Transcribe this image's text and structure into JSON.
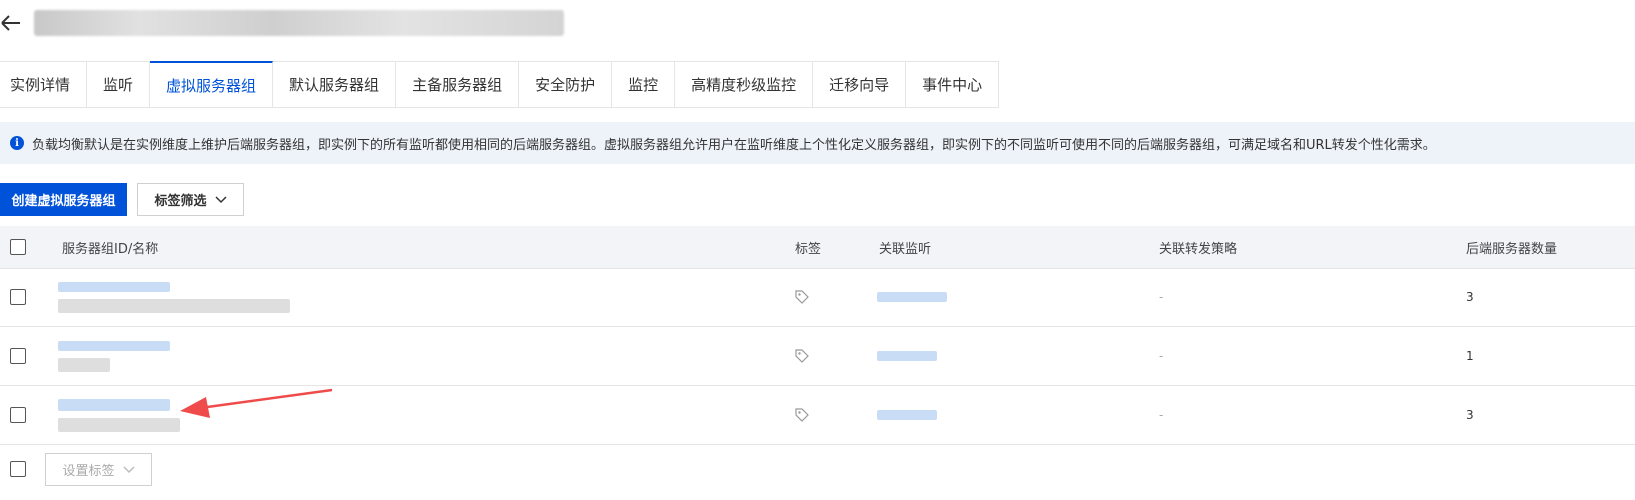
{
  "tabs": [
    {
      "label": "实例详情"
    },
    {
      "label": "监听"
    },
    {
      "label": "虚拟服务器组",
      "active": true
    },
    {
      "label": "默认服务器组"
    },
    {
      "label": "主备服务器组"
    },
    {
      "label": "安全防护"
    },
    {
      "label": "监控"
    },
    {
      "label": "高精度秒级监控"
    },
    {
      "label": "迁移向导"
    },
    {
      "label": "事件中心"
    }
  ],
  "info": {
    "text": "负载均衡默认是在实例维度上维护后端服务器组，即实例下的所有监听都使用相同的后端服务器组。虚拟服务器组允许用户在监听维度上个性化定义服务器组，即实例下的不同监听可使用不同的后端服务器组，可满足域名和URL转发个性化需求。"
  },
  "toolbar": {
    "create_label": "创建虚拟服务器组",
    "tag_filter_label": "标签筛选"
  },
  "table": {
    "headers": {
      "id_name": "服务器组ID/名称",
      "tag": "标签",
      "listener": "关联监听",
      "policy": "关联转发策略",
      "count": "后端服务器数量"
    },
    "rows": [
      {
        "policy": "-",
        "count": "3"
      },
      {
        "policy": "-",
        "count": "1"
      },
      {
        "policy": "-",
        "count": "3"
      }
    ]
  },
  "footer": {
    "set_tag_label": "设置标签"
  },
  "colors": {
    "accent": "#0052d9",
    "annotation_arrow": "#f04b4b"
  }
}
